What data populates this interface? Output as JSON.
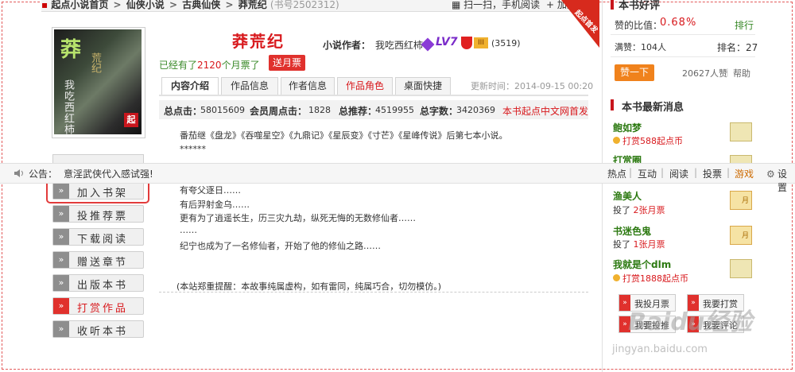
{
  "breadcrumb": {
    "home": "起点小说首页",
    "category": "仙侠小说",
    "subcategory": "古典仙侠",
    "book": "莽荒纪",
    "book_id": "(书号2502312)"
  },
  "top_links": {
    "scan": "扫一扫，手机阅读",
    "collect": "加入收藏"
  },
  "book": {
    "title": "莽荒纪",
    "author_label": "小说作者：",
    "author_name": "我吃西红柿",
    "level": "LV7",
    "fan_badge": "III",
    "score": "(3519)",
    "ribbon": "起点首发",
    "cover": {
      "title_big": "莽",
      "title_rest": "荒纪",
      "author": "我吃西红柿",
      "logo": "起"
    }
  },
  "monthly": {
    "prefix": "已经有了",
    "count": "2120",
    "suffix": "个月票了",
    "button": "送月票"
  },
  "tabs": [
    "内容介绍",
    "作品信息",
    "作者信息",
    "作品角色",
    "桌面快捷"
  ],
  "update_time": "更新时间：2014-09-15 00:20",
  "stats": {
    "total_clicks_label": "总点击：",
    "total_clicks": "58015609",
    "member_weekly_label": "会员周点击：",
    "member_weekly": "1828",
    "total_recommend_label": "总推荐：",
    "total_recommend": "4519955",
    "total_words_label": "总字数：",
    "total_words": "3420369",
    "first_release": "本书起点中文网首发"
  },
  "description": {
    "lines": [
      "番茄继《盘龙》《吞噬星空》《九鼎记》《星辰变》《寸芒》《星峰传说》后第七本小说。",
      "******",
      "有夸父逐日……",
      "有后羿射金乌……",
      "更有为了逍遥长生，历三灾九劫，纵死无悔的无数修仙者……",
      "……",
      "纪宁也成为了一名修仙者，开始了他的修仙之路……"
    ],
    "note": "(本站郑重提醒：本故事纯属虚构，如有雷同，纯属巧合，切勿模仿。)"
  },
  "notice": {
    "label": "公告：",
    "text": "意淫武侠代入感试强!",
    "nav": [
      "热点",
      "互动",
      "阅读",
      "投票",
      "游戏"
    ],
    "settings": "设置"
  },
  "actions": [
    "加入书架",
    "投推荐票",
    "下载阅读",
    "赠送章节",
    "出版本书",
    "打赏作品",
    "收听本书"
  ],
  "sidebar": {
    "top_title": "本书好评",
    "ratio_label": "赞的比值：",
    "ratio_value": "0.68%",
    "rank_link": "排行",
    "manzan": "满赞：104人",
    "rank": "排名：27",
    "zan_button": "赞一下",
    "zan_count": "20627人赞",
    "help": "帮助",
    "news_title": "本书最新消息",
    "messages": [
      {
        "name": "鲍如梦",
        "pre": "打赏",
        "amount": "588起点币",
        "post": "",
        "icon": "gift"
      },
      {
        "name": "渔美人",
        "pre": "投了 ",
        "amount": "2张月票",
        "post": "",
        "icon": "月"
      },
      {
        "name": "书迷色鬼",
        "pre": "投了 ",
        "amount": "1张月票",
        "post": "",
        "icon": "月"
      },
      {
        "name": "我就是个dlm",
        "pre": "打赏",
        "amount": "1888起点币",
        "post": "",
        "icon": "gift"
      }
    ],
    "btn_vote": "我投月票",
    "btn_reward": "我要打赏",
    "btn_tl": "我要投推",
    "btn_review": "我要评论"
  },
  "watermark": {
    "main": "Baidu经验",
    "url": "jingyan.baidu.com"
  },
  "colors": {
    "brand_red": "#d8191d",
    "orange": "#f0821c",
    "green": "#2d7a12",
    "purple": "#7a2bc9"
  }
}
